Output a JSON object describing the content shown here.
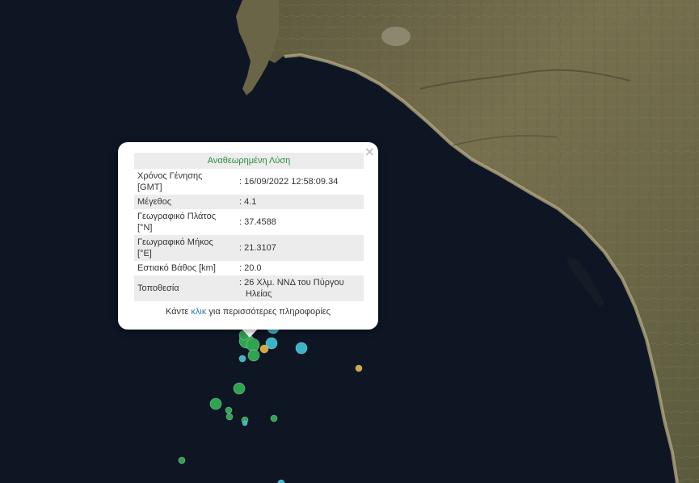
{
  "popup": {
    "title": "Αναθεωρημένη Λύση",
    "close_symbol": "×",
    "rows": [
      {
        "label_line1": "Χρόνος Γένησης",
        "label_line2": "[GMT]",
        "value_line1": ": 16/09/2022 12:58:09.34",
        "value_line2": ""
      },
      {
        "label_line1": "Μέγεθος",
        "label_line2": "",
        "value_line1": ": 4.1",
        "value_line2": ""
      },
      {
        "label_line1": "Γεωγραφικό Πλάτος",
        "label_line2": "[°N]",
        "value_line1": ": 37.4588",
        "value_line2": ""
      },
      {
        "label_line1": "Γεωγραφικό Μήκος",
        "label_line2": "[°E]",
        "value_line1": ": 21.3107",
        "value_line2": ""
      },
      {
        "label_line1": "Εστιακό Βάθος [km]",
        "label_line2": "",
        "value_line1": ": 20.0",
        "value_line2": ""
      },
      {
        "label_line1": "Τοποθεσία",
        "label_line2": "",
        "value_line1": ": 26 Χλμ. ΝΝΔ του Πύργου",
        "value_line2": "Ηλείας"
      }
    ],
    "footer_prefix": "Κάντε ",
    "footer_link": "κλικ",
    "footer_suffix": " για περισσότερες πληροφορίες"
  },
  "colors": {
    "sea": "#0e1624",
    "land": "#6d6547",
    "marker_green": "#2ea44f",
    "marker_cyan": "#38b6c9",
    "marker_yellow": "#d4a83a",
    "title_green": "#2e8b3a",
    "link_blue": "#2b7bb9"
  },
  "markers_legend_icons": [
    "earthquake-marker-green",
    "earthquake-marker-cyan",
    "earthquake-marker-yellow"
  ]
}
